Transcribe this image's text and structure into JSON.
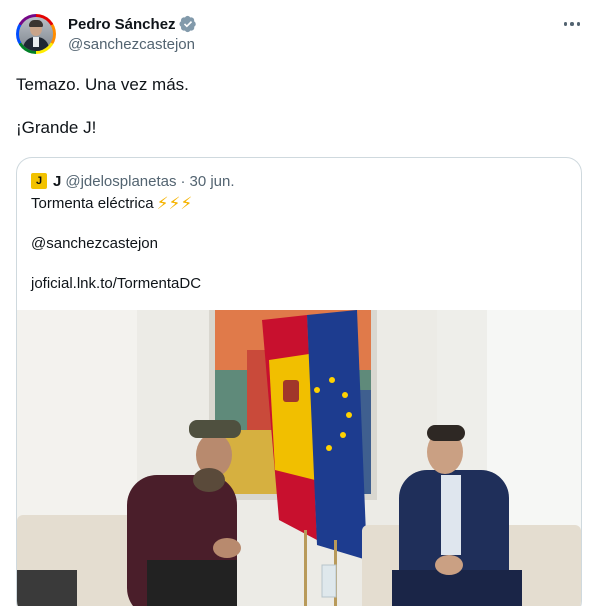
{
  "author": {
    "display_name": "Pedro Sánchez",
    "handle": "@sanchezcastejon",
    "verified": true,
    "avatar": "profile-photo-with-rainbow-ring"
  },
  "tweet": {
    "lines": [
      "Temazo. Una vez más.",
      "¡Grande J!"
    ]
  },
  "quoted": {
    "avatar_letter": "J",
    "display_name": "J",
    "handle": "@jdelosplanetas",
    "separator": "·",
    "date": "30 jun.",
    "text_line1": "Tormenta eléctrica",
    "emoji": "⚡⚡⚡",
    "mention": "@sanchezcastejon",
    "link": "joficial.lnk.to/TormentaDC",
    "media": "photo-two-men-seated-flags"
  },
  "colors": {
    "verified_badge": "#829aab",
    "secondary_text": "#536471",
    "border": "#cfd9de",
    "bolt": "#f5b301"
  },
  "icons": {
    "more": "more-horizontal-icon",
    "verified": "verified-badge-icon"
  }
}
